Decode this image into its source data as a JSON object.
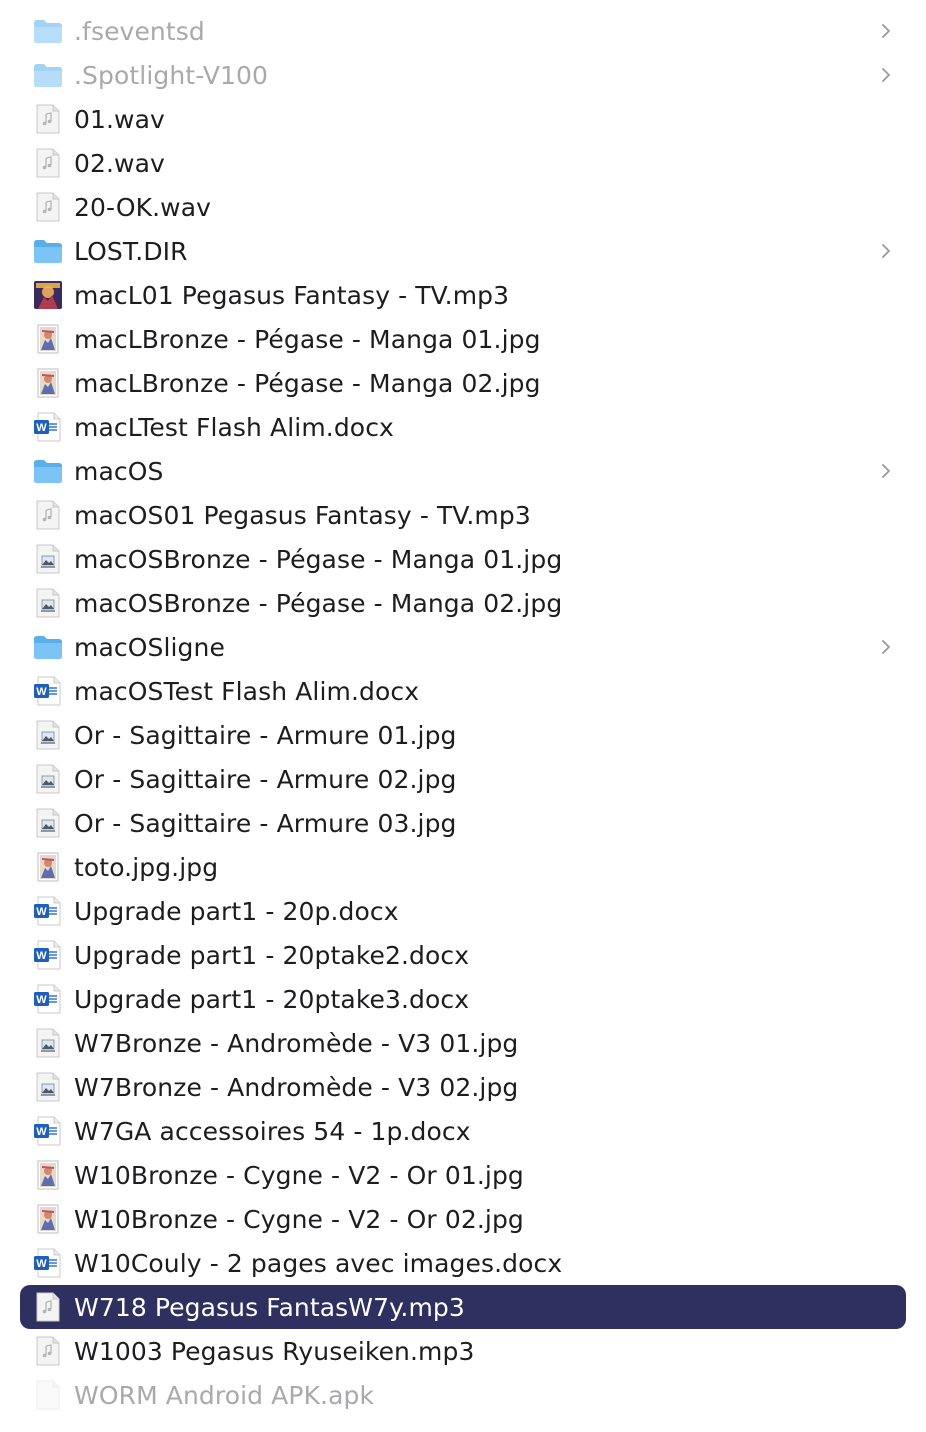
{
  "files": [
    {
      "name": ".fseventsd",
      "icon": "folder-icon",
      "folder": true,
      "dim": true
    },
    {
      "name": ".Spotlight-V100",
      "icon": "folder-icon",
      "folder": true,
      "dim": true
    },
    {
      "name": "01.wav",
      "icon": "audio-file-icon"
    },
    {
      "name": "02.wav",
      "icon": "audio-file-icon"
    },
    {
      "name": "20-OK.wav",
      "icon": "audio-file-icon"
    },
    {
      "name": "LOST.DIR",
      "icon": "folder-icon",
      "folder": true
    },
    {
      "name": "macL01 Pegasus Fantasy - TV.mp3",
      "icon": "album-art-icon"
    },
    {
      "name": "macLBronze - Pégase - Manga 01.jpg",
      "icon": "image-thumbnail-icon"
    },
    {
      "name": "macLBronze - Pégase - Manga 02.jpg",
      "icon": "image-thumbnail-icon"
    },
    {
      "name": "macLTest Flash Alim.docx",
      "icon": "word-document-icon"
    },
    {
      "name": "macOS",
      "icon": "folder-icon",
      "folder": true
    },
    {
      "name": "macOS01 Pegasus Fantasy - TV.mp3",
      "icon": "audio-file-icon"
    },
    {
      "name": "macOSBronze - Pégase - Manga 01.jpg",
      "icon": "image-file-icon"
    },
    {
      "name": "macOSBronze - Pégase - Manga 02.jpg",
      "icon": "image-file-icon"
    },
    {
      "name": "macOSligne",
      "icon": "folder-icon",
      "folder": true
    },
    {
      "name": "macOSTest Flash Alim.docx",
      "icon": "word-document-icon"
    },
    {
      "name": "Or - Sagittaire - Armure 01.jpg",
      "icon": "image-file-icon"
    },
    {
      "name": "Or - Sagittaire - Armure 02.jpg",
      "icon": "image-file-icon"
    },
    {
      "name": "Or - Sagittaire - Armure 03.jpg",
      "icon": "image-file-icon"
    },
    {
      "name": "toto.jpg.jpg",
      "icon": "image-thumbnail-icon"
    },
    {
      "name": "Upgrade part1 - 20p.docx",
      "icon": "word-document-icon"
    },
    {
      "name": "Upgrade part1 - 20ptake2.docx",
      "icon": "word-document-icon"
    },
    {
      "name": "Upgrade part1 - 20ptake3.docx",
      "icon": "word-document-icon"
    },
    {
      "name": "W7Bronze - Andromède - V3 01.jpg",
      "icon": "image-file-icon"
    },
    {
      "name": "W7Bronze - Andromède - V3 02.jpg",
      "icon": "image-file-icon"
    },
    {
      "name": "W7GA accessoires 54 - 1p.docx",
      "icon": "word-document-icon"
    },
    {
      "name": "W10Bronze - Cygne - V2 - Or 01.jpg",
      "icon": "image-thumbnail-icon"
    },
    {
      "name": "W10Bronze - Cygne - V2 - Or 02.jpg",
      "icon": "image-thumbnail-icon"
    },
    {
      "name": "W10Couly - 2 pages avec images.docx",
      "icon": "word-document-icon"
    },
    {
      "name": "W718 Pegasus FantasW7y.mp3",
      "icon": "audio-file-icon",
      "selected": true
    },
    {
      "name": "W1003 Pegasus Ryuseiken.mp3",
      "icon": "audio-file-icon"
    },
    {
      "name": "WORM Android APK.apk",
      "icon": "blank-file-icon",
      "dim": true,
      "ghost": true
    }
  ],
  "colors": {
    "selection": "#2e3160",
    "folder": "#6cb8f0",
    "word_blue": "#1e5fba",
    "dim_text": "#a9a9ab"
  }
}
